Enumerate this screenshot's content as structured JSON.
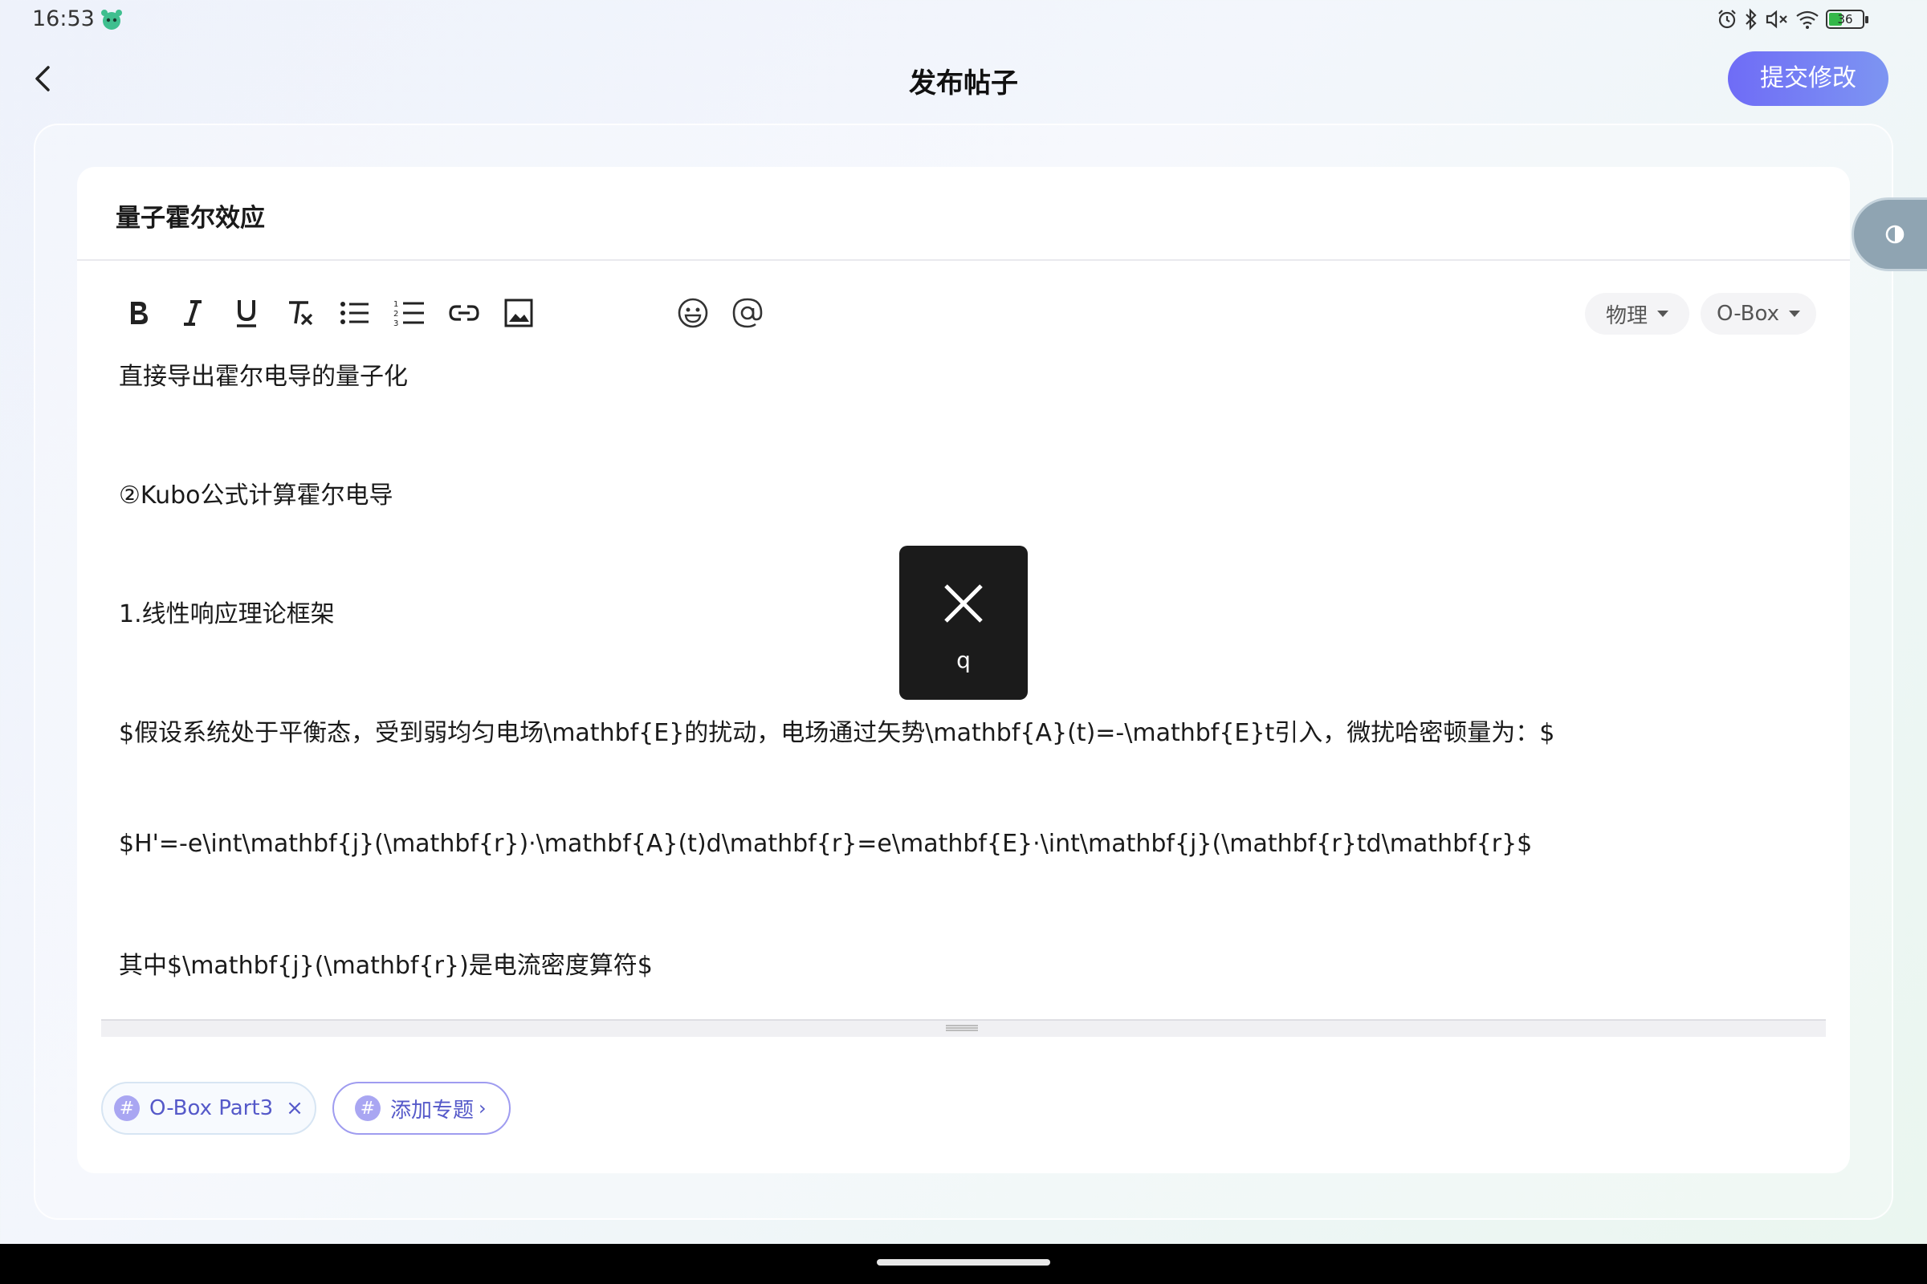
{
  "status_bar": {
    "time": "16:53",
    "battery_level": "36",
    "icons": [
      "alarm-icon",
      "bluetooth-icon",
      "mute-icon",
      "wifi-icon",
      "battery-icon"
    ]
  },
  "header": {
    "title": "发布帖子",
    "submit_label": "提交修改"
  },
  "post": {
    "title": "量子霍尔效应"
  },
  "toolbar": {
    "tools": [
      "bold",
      "italic",
      "underline",
      "clear-format",
      "bullet-list",
      "numbered-list",
      "link",
      "image",
      "emoji",
      "mention"
    ],
    "category_label": "物理",
    "board_label": "O-Box"
  },
  "editor": {
    "lines": [
      "直接导出霍尔电导的量子化",
      "②Kubo公式计算霍尔电导",
      "1.线性响应理论框架",
      "$假设系统处于平衡态，受到弱均匀电场\\mathbf{E}的扰动，电场通过矢势\\mathbf{A}(t)=-\\mathbf{E}t引入，微扰哈密顿量为：$",
      "$H'=-e\\int\\mathbf{j}(\\mathbf{r})·\\mathbf{A}(t)d\\mathbf{r}=e\\mathbf{E}·\\int\\mathbf{j}(\\mathbf{r}td\\mathbf{r}$",
      "其中$\\mathbf{j}(\\mathbf{r})是电流密度算符$"
    ]
  },
  "topics": {
    "selected": "O-Box Part3",
    "add_label": "添加专题",
    "hash_symbol": "#",
    "close_symbol": "×",
    "arrow_symbol": "›"
  },
  "key_popup": {
    "letter": "q"
  },
  "colors": {
    "accent": "#6f6cf6",
    "accent_end": "#7d95f2",
    "chip_text": "#5559c9"
  }
}
